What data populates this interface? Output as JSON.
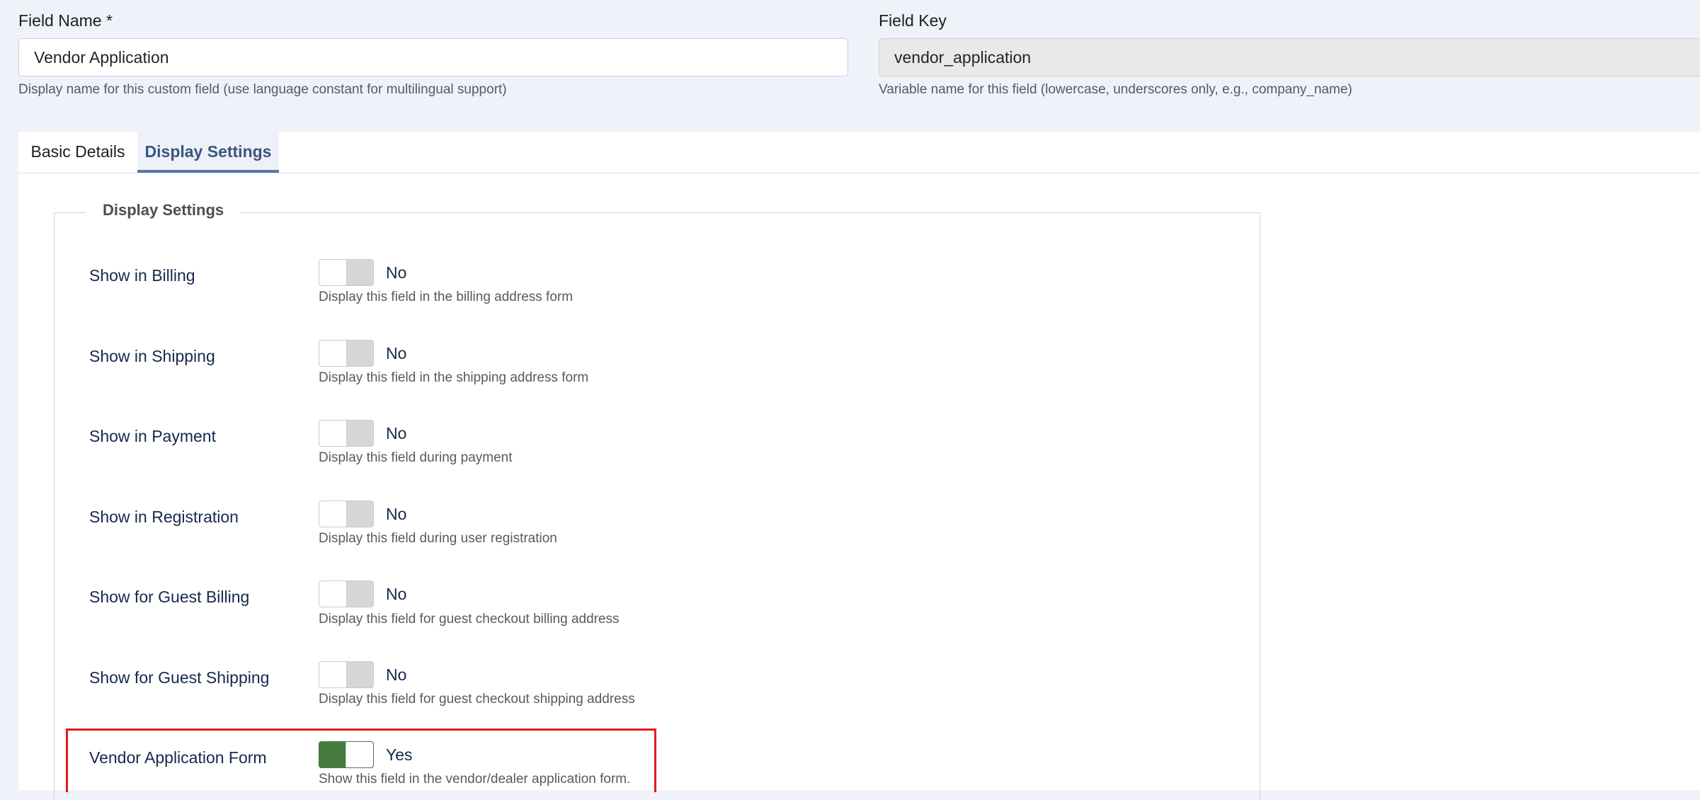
{
  "field_name": {
    "label": "Field Name *",
    "value": "Vendor Application",
    "hint": "Display name for this custom field (use language constant for multilingual support)"
  },
  "field_key": {
    "label": "Field Key",
    "value": "vendor_application",
    "hint": "Variable name for this field (lowercase, underscores only, e.g., company_name)"
  },
  "tabs": [
    {
      "label": "Basic Details",
      "active": false
    },
    {
      "label": "Display Settings",
      "active": true
    }
  ],
  "display_settings": {
    "legend": "Display Settings",
    "rows": [
      {
        "label": "Show in Billing",
        "state": "No",
        "on": false,
        "hint": "Display this field in the billing address form"
      },
      {
        "label": "Show in Shipping",
        "state": "No",
        "on": false,
        "hint": "Display this field in the shipping address form"
      },
      {
        "label": "Show in Payment",
        "state": "No",
        "on": false,
        "hint": "Display this field during payment"
      },
      {
        "label": "Show in Registration",
        "state": "No",
        "on": false,
        "hint": "Display this field during user registration"
      },
      {
        "label": "Show for Guest Billing",
        "state": "No",
        "on": false,
        "hint": "Display this field for guest checkout billing address"
      },
      {
        "label": "Show for Guest Shipping",
        "state": "No",
        "on": false,
        "hint": "Display this field for guest checkout shipping address"
      },
      {
        "label": "Vendor Application Form",
        "state": "Yes",
        "on": true,
        "hint": "Show this field in the vendor/dealer application form."
      }
    ]
  },
  "colors": {
    "switch_on": "#457a3d",
    "switch_off": "#d6d6d6",
    "highlight": "#e3191e",
    "active_tab": "#3b5482"
  }
}
